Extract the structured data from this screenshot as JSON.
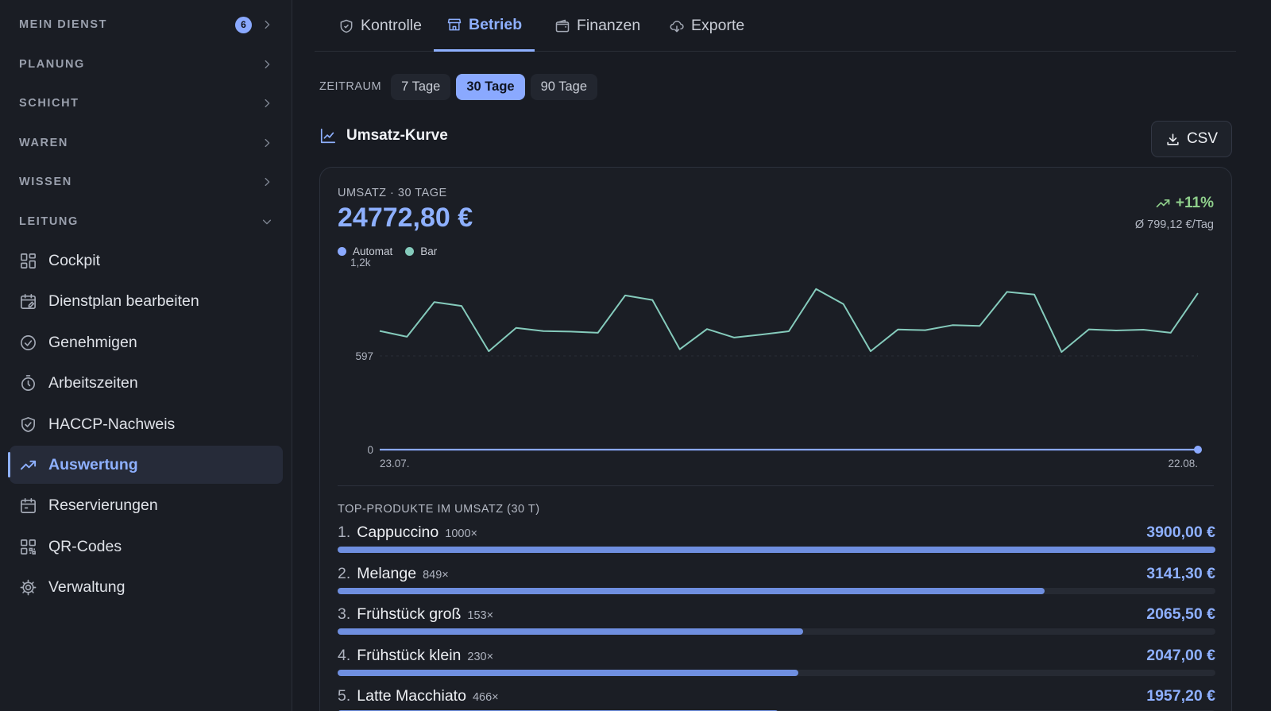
{
  "sidebar": {
    "sections": [
      {
        "label": "MEIN DIENST",
        "badge": "6",
        "expanded": false
      },
      {
        "label": "PLANUNG",
        "expanded": false
      },
      {
        "label": "SCHICHT",
        "expanded": false
      },
      {
        "label": "WAREN",
        "expanded": false
      },
      {
        "label": "WISSEN",
        "expanded": false
      },
      {
        "label": "LEITUNG",
        "expanded": true
      }
    ],
    "items": [
      {
        "label": "Cockpit",
        "icon": "grid-icon"
      },
      {
        "label": "Dienstplan bearbeiten",
        "icon": "calendar-edit-icon"
      },
      {
        "label": "Genehmigen",
        "icon": "check-circle-icon"
      },
      {
        "label": "Arbeitszeiten",
        "icon": "stopwatch-icon"
      },
      {
        "label": "HACCP-Nachweis",
        "icon": "shield-check-icon"
      },
      {
        "label": "Auswertung",
        "icon": "trending-up-icon",
        "active": true
      },
      {
        "label": "Reservierungen",
        "icon": "calendar-icon"
      },
      {
        "label": "QR-Codes",
        "icon": "qr-code-icon"
      },
      {
        "label": "Verwaltung",
        "icon": "gear-icon"
      }
    ]
  },
  "tabs": [
    {
      "label": "Kontrolle",
      "icon": "shield-icon"
    },
    {
      "label": "Betrieb",
      "icon": "store-icon",
      "active": true
    },
    {
      "label": "Finanzen",
      "icon": "wallet-icon"
    },
    {
      "label": "Exporte",
      "icon": "cloud-download-icon"
    }
  ],
  "period": {
    "label": "ZEITRAUM",
    "options": [
      "7 Tage",
      "30 Tage",
      "90 Tage"
    ],
    "selected": "30 Tage"
  },
  "section": {
    "title": "Umsatz-Kurve",
    "csv_label": "CSV"
  },
  "kpi": {
    "label": "UMSATZ · 30 TAGE",
    "value": "24772,80 €",
    "trend": "+11%",
    "average": "Ø 799,12 €/Tag"
  },
  "colors": {
    "accent": "#8eb0ff",
    "automat": "#8aa9ff",
    "bar": "#85cbbc",
    "trend_positive": "#8fcf8b"
  },
  "chart_data": {
    "type": "line",
    "x_first_label": "23.07.",
    "x_last_label": "22.08.",
    "y_ticks": [
      "1,2k",
      "597",
      "0"
    ],
    "ylim": [
      0,
      1194
    ],
    "series": [
      {
        "name": "Automat",
        "color": "#8aa9ff",
        "values": [
          0,
          0,
          0,
          0,
          0,
          0,
          0,
          0,
          0,
          0,
          0,
          0,
          0,
          0,
          0,
          0,
          0,
          0,
          0,
          0,
          0,
          0,
          0,
          0,
          0,
          0,
          0,
          0,
          0,
          0,
          0
        ]
      },
      {
        "name": "Bar",
        "color": "#85cbbc",
        "values": [
          756,
          719,
          940,
          915,
          627,
          775,
          755,
          752,
          744,
          982,
          953,
          639,
          768,
          714,
          733,
          754,
          1023,
          927,
          627,
          765,
          761,
          793,
          788,
          1005,
          988,
          622,
          766,
          759,
          764,
          744,
          996
        ]
      }
    ]
  },
  "top_products": {
    "label": "TOP-PRODUKTE IM UMSATZ (30 T)",
    "items": [
      {
        "rank": "1.",
        "name": "Cappuccino",
        "qty": "1000×",
        "amount": "3900,00 €",
        "share": 1.0
      },
      {
        "rank": "2.",
        "name": "Melange",
        "qty": "849×",
        "amount": "3141,30 €",
        "share": 0.805
      },
      {
        "rank": "3.",
        "name": "Frühstück groß",
        "qty": "153×",
        "amount": "2065,50 €",
        "share": 0.53
      },
      {
        "rank": "4.",
        "name": "Frühstück klein",
        "qty": "230×",
        "amount": "2047,00 €",
        "share": 0.525
      },
      {
        "rank": "5.",
        "name": "Latte Macchiato",
        "qty": "466×",
        "amount": "1957,20 €",
        "share": 0.502
      }
    ]
  }
}
